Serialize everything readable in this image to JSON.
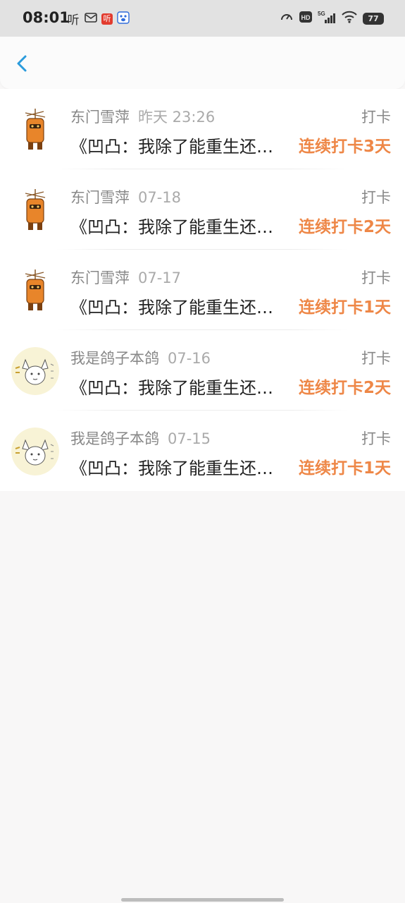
{
  "status_bar": {
    "time": "08:01",
    "apps": [
      "听",
      "mail-icon",
      "听",
      "baidu-icon"
    ],
    "network": "5G",
    "hd": "HD",
    "battery": "77"
  },
  "nav": {
    "back_icon": "chevron-left-icon"
  },
  "colors": {
    "accent_orange": "#ee8747",
    "back_blue": "#2a9bdc"
  },
  "records": [
    {
      "user": "东门雪萍",
      "time": "昨天 23:26",
      "action": "打卡",
      "title": "《凹凸：我除了能重生还能做什么》",
      "streak": "连续打卡3天",
      "avatar": "robot-avatar"
    },
    {
      "user": "东门雪萍",
      "time": "07-18",
      "action": "打卡",
      "title": "《凹凸：我除了能重生还能做什么》",
      "streak": "连续打卡2天",
      "avatar": "robot-avatar"
    },
    {
      "user": "东门雪萍",
      "time": "07-17",
      "action": "打卡",
      "title": "《凹凸：我除了能重生还能做什么》",
      "streak": "连续打卡1天",
      "avatar": "robot-avatar"
    },
    {
      "user": "我是鸽子本鸽",
      "time": "07-16",
      "action": "打卡",
      "title": "《凹凸：我除了能重生还能做什么》",
      "streak": "连续打卡2天",
      "avatar": "fox-avatar"
    },
    {
      "user": "我是鸽子本鸽",
      "time": "07-15",
      "action": "打卡",
      "title": "《凹凸：我除了能重生还能做什么》",
      "streak": "连续打卡1天",
      "avatar": "fox-avatar"
    }
  ]
}
